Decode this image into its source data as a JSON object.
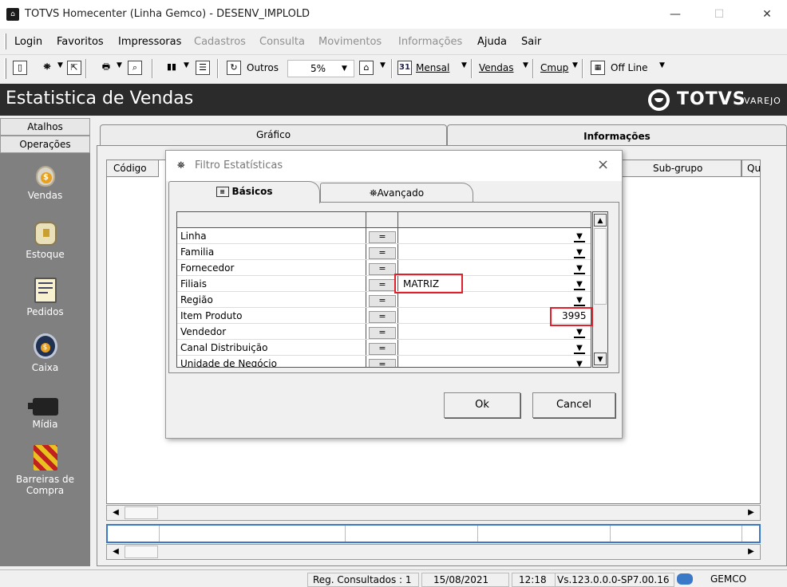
{
  "window": {
    "title": "TOTVS Homecenter (Linha Gemco) - DESENV_IMPLOLD",
    "icon": "home-icon"
  },
  "menu": [
    {
      "label": "Login",
      "enabled": true
    },
    {
      "label": "Favoritos",
      "enabled": true
    },
    {
      "label": "Impressoras",
      "enabled": true
    },
    {
      "label": "Cadastros",
      "enabled": false
    },
    {
      "label": "Consulta",
      "enabled": false
    },
    {
      "label": "Movimentos",
      "enabled": false
    },
    {
      "label": "Informações",
      "enabled": false
    },
    {
      "label": "Ajuda",
      "enabled": true
    },
    {
      "label": "Sair",
      "enabled": true
    }
  ],
  "toolbar": {
    "outros_label": "Outros",
    "percent_value": "5%",
    "mensal_label": "Mensal",
    "vendas_label": "Vendas",
    "cmup_label": "Cmup",
    "offline_label": "Off Line",
    "calendar_day": "31"
  },
  "header": {
    "title": "Estatistica de Vendas",
    "logo_text": "TOTVS",
    "logo_sub": "VAREJO"
  },
  "sidebar": {
    "tabs": [
      "Atalhos",
      "Operações"
    ],
    "items": [
      {
        "label": "Vendas",
        "icon": "money-bag-icon"
      },
      {
        "label": "Estoque",
        "icon": "stock-box-icon"
      },
      {
        "label": "Pedidos",
        "icon": "order-documents-icon"
      },
      {
        "label": "Caixa",
        "icon": "cash-register-icon"
      },
      {
        "label": "Mídia",
        "icon": "camera-icon"
      },
      {
        "label": "Barreiras de Compra",
        "icon": "barrier-icon"
      }
    ]
  },
  "main": {
    "tabs": [
      {
        "label": "Gráfico",
        "active": false
      },
      {
        "label": "Informações",
        "active": true
      }
    ],
    "columns": [
      "Código",
      "Sub-grupo",
      "Qu"
    ]
  },
  "dialog": {
    "title": "Filtro  Estatísticas",
    "tabs": [
      {
        "label": "Básicos",
        "active": true
      },
      {
        "label": "Avançado",
        "active": false
      }
    ],
    "operator": "=",
    "rows": [
      {
        "label": "Linha",
        "value": ""
      },
      {
        "label": "Familia",
        "value": ""
      },
      {
        "label": "Fornecedor",
        "value": ""
      },
      {
        "label": "Filiais",
        "value": "MATRIZ"
      },
      {
        "label": "Região",
        "value": ""
      },
      {
        "label": "Item Produto",
        "value": "3995"
      },
      {
        "label": "Vendedor",
        "value": ""
      },
      {
        "label": "Canal Distribuição",
        "value": ""
      },
      {
        "label": "Unidade de Negócio",
        "value": ""
      }
    ],
    "ok_label": "Ok",
    "cancel_label": "Cancel"
  },
  "status": {
    "records": "Reg. Consultados : 1",
    "date": "15/08/2021",
    "time": "12:18",
    "version": "Vs.123.0.0.0-SP7.00.16",
    "system": "GEMCO"
  },
  "colors": {
    "highlight": "#e0202a",
    "header_bg": "#2b2b2b",
    "sidebar_bg": "#808080",
    "selection": "#3a78c8"
  }
}
